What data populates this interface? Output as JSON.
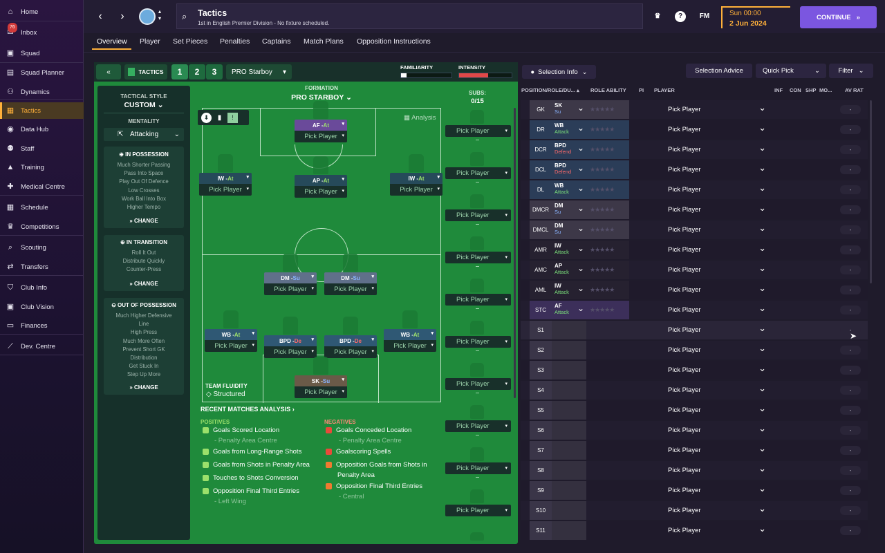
{
  "sidebar": {
    "items": [
      {
        "label": "Home",
        "icon": "home-icon",
        "glyph": "⌂"
      },
      {
        "label": "Inbox",
        "icon": "inbox-icon",
        "glyph": "✉",
        "badge": "76"
      },
      {
        "label": "Squad",
        "icon": "squad-icon",
        "glyph": "▣"
      },
      {
        "label": "Squad Planner",
        "icon": "planner-icon",
        "glyph": "▤"
      },
      {
        "label": "Dynamics",
        "icon": "dynamics-icon",
        "glyph": "⚇"
      },
      {
        "label": "Tactics",
        "icon": "tactics-icon",
        "glyph": "▦",
        "active": true
      },
      {
        "label": "Data Hub",
        "icon": "data-hub-icon",
        "glyph": "◉"
      },
      {
        "label": "Staff",
        "icon": "staff-icon",
        "glyph": "⚉"
      },
      {
        "label": "Training",
        "icon": "training-icon",
        "glyph": "▲"
      },
      {
        "label": "Medical Centre",
        "icon": "medical-icon",
        "glyph": "✚"
      },
      {
        "label": "Schedule",
        "icon": "schedule-icon",
        "glyph": "▦"
      },
      {
        "label": "Competitions",
        "icon": "trophy-icon",
        "glyph": "♛"
      },
      {
        "label": "Scouting",
        "icon": "scouting-icon",
        "glyph": "⌕"
      },
      {
        "label": "Transfers",
        "icon": "transfers-icon",
        "glyph": "⇄"
      },
      {
        "label": "Club Info",
        "icon": "club-info-icon",
        "glyph": "⛉"
      },
      {
        "label": "Club Vision",
        "icon": "club-vision-icon",
        "glyph": "▣"
      },
      {
        "label": "Finances",
        "icon": "finances-icon",
        "glyph": "▭"
      },
      {
        "label": "Dev. Centre",
        "icon": "dev-centre-icon",
        "glyph": "⟋"
      }
    ]
  },
  "header": {
    "title": "Tactics",
    "subtitle": "1st in English Premier Division - No fixture scheduled.",
    "fm_label": "FM",
    "date_line1": "Sun 00:00",
    "date_line2": "2 Jun 2024",
    "continue_label": "CONTINUE"
  },
  "subtabs": [
    "Overview",
    "Player",
    "Set Pieces",
    "Penalties",
    "Captains",
    "Match Plans",
    "Opposition Instructions"
  ],
  "tactics_bar": {
    "label": "TACTICS",
    "slots": [
      "1",
      "2",
      "3"
    ],
    "tactic_name": "PRO Starboy",
    "familiarity_label": "FAMILIARITY",
    "intensity_label": "INTENSITY"
  },
  "left_col": {
    "style_label": "TACTICAL STYLE",
    "style_value": "CUSTOM",
    "mentality_label": "MENTALITY",
    "mentality_value": "Attacking",
    "in_possession": {
      "title": "IN POSSESSION",
      "items": [
        "Much Shorter Passing",
        "Pass Into Space",
        "Play Out Of Defence",
        "Low Crosses",
        "Work Ball Into Box",
        "Higher Tempo"
      ]
    },
    "in_transition": {
      "title": "IN TRANSITION",
      "items": [
        "Roll It Out",
        "Distribute Quickly",
        "Counter-Press"
      ]
    },
    "out_of_possession": {
      "title": "OUT OF POSSESSION",
      "items": [
        "Much Higher Defensive",
        "Line",
        "High Press",
        "Much More Often",
        "Prevent Short GK",
        "Distribution",
        "Get Stuck In",
        "Step Up More"
      ]
    },
    "change_label": "CHANGE"
  },
  "formation": {
    "label": "FORMATION",
    "value": "PRO STARBOY",
    "subs_label": "SUBS:",
    "subs_value": "0/15",
    "analysis_label": "Analysis",
    "team_fluidity_label": "TEAM FLUIDITY",
    "team_fluidity_value": "Structured",
    "positions": [
      {
        "role": "AF",
        "duty": "At",
        "color": "#6a4a9a"
      },
      {
        "role": "IW",
        "duty": "At",
        "color": "#264a5a"
      },
      {
        "role": "AP",
        "duty": "At",
        "color": "#264a5a"
      },
      {
        "role": "IW",
        "duty": "At",
        "color": "#264a5a"
      },
      {
        "role": "DM",
        "duty": "Su",
        "color": "#60708a"
      },
      {
        "role": "DM",
        "duty": "Su",
        "color": "#60708a"
      },
      {
        "role": "WB",
        "duty": "At",
        "color": "#2f5874"
      },
      {
        "role": "BPD",
        "duty": "De",
        "color": "#2f5874"
      },
      {
        "role": "BPD",
        "duty": "De",
        "color": "#2f5874"
      },
      {
        "role": "WB",
        "duty": "At",
        "color": "#2f5874"
      },
      {
        "role": "SK",
        "duty": "Su",
        "color": "#6a5a48"
      }
    ],
    "pick_label": "Pick Player"
  },
  "analysis": {
    "title": "RECENT MATCHES ANALYSIS",
    "positives_label": "POSITIVES",
    "negatives_label": "NEGATIVES",
    "positives": [
      {
        "text": "Goals Scored Location",
        "sub": "- Penalty Area Centre"
      },
      {
        "text": "Goals from Long-Range Shots",
        "sub": ""
      },
      {
        "text": "Goals from Shots in Penalty Area",
        "sub": ""
      },
      {
        "text": "Touches to Shots Conversion",
        "sub": ""
      },
      {
        "text": "Opposition Final Third Entries",
        "sub": "- Left Wing"
      }
    ],
    "negatives": [
      {
        "text": "Goals Conceded Location",
        "sub": "- Penalty Area Centre"
      },
      {
        "text": "Goalscoring Spells",
        "sub": ""
      },
      {
        "text": "Opposition Goals from Shots in",
        "sub": "Penalty Area"
      },
      {
        "text": "Opposition Final Third Entries",
        "sub": "- Central"
      }
    ]
  },
  "right_panel": {
    "selection_info_label": "Selection Info",
    "selection_advice_label": "Selection Advice",
    "quick_pick_label": "Quick Pick",
    "filter_label": "Filter",
    "columns": [
      "POSITION/ROLE/DU...",
      "ROLE ABILITY",
      "PI",
      "PLAYER",
      "INF",
      "CON",
      "SHP",
      "MO...",
      "AV RAT"
    ],
    "rows": [
      {
        "pos": "GK",
        "role": "SK",
        "duty": "Su",
        "bg": "#3d3848",
        "dutycolor": "#8ab4ff"
      },
      {
        "pos": "DR",
        "role": "WB",
        "duty": "Attack",
        "bg": "#2b3d58",
        "dutycolor": "#7be07b"
      },
      {
        "pos": "DCR",
        "role": "BPD",
        "duty": "Defend",
        "bg": "#2b3d58",
        "dutycolor": "#ff6a6a"
      },
      {
        "pos": "DCL",
        "role": "BPD",
        "duty": "Defend",
        "bg": "#2b3d58",
        "dutycolor": "#ff6a6a"
      },
      {
        "pos": "DL",
        "role": "WB",
        "duty": "Attack",
        "bg": "#2b3d58",
        "dutycolor": "#7be07b"
      },
      {
        "pos": "DMCR",
        "role": "DM",
        "duty": "Su",
        "bg": "#3d3848",
        "dutycolor": "#8ab4ff"
      },
      {
        "pos": "DMCL",
        "role": "DM",
        "duty": "Su",
        "bg": "#3d3848",
        "dutycolor": "#8ab4ff"
      },
      {
        "pos": "AMR",
        "role": "IW",
        "duty": "Attack",
        "bg": "#262130",
        "dutycolor": "#7be07b"
      },
      {
        "pos": "AMC",
        "role": "AP",
        "duty": "Attack",
        "bg": "#262130",
        "dutycolor": "#7be07b"
      },
      {
        "pos": "AML",
        "role": "IW",
        "duty": "Attack",
        "bg": "#262130",
        "dutycolor": "#7be07b"
      },
      {
        "pos": "STC",
        "role": "AF",
        "duty": "Attack",
        "bg": "#3c2f5a",
        "dutycolor": "#7be07b"
      },
      {
        "pos": "S1"
      },
      {
        "pos": "S2"
      },
      {
        "pos": "S3"
      },
      {
        "pos": "S4"
      },
      {
        "pos": "S5"
      },
      {
        "pos": "S6"
      },
      {
        "pos": "S7"
      },
      {
        "pos": "S8"
      },
      {
        "pos": "S9"
      },
      {
        "pos": "S10"
      },
      {
        "pos": "S11"
      }
    ],
    "pick_label": "Pick Player",
    "av_dash": "-"
  }
}
